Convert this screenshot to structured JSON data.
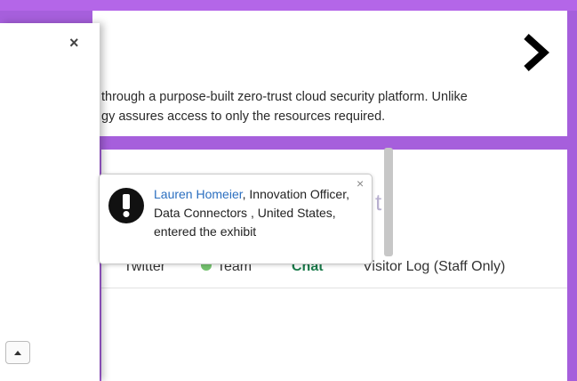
{
  "description": {
    "line1": "through a purpose-built zero-trust cloud security platform. Unlike",
    "line2": "gy assures access to only the resources required."
  },
  "navigation": {
    "next_icon": "chevron-right-icon"
  },
  "tabs": {
    "twitter": "Twitter",
    "team": "Team",
    "chat": "Chat",
    "visitor_log": "Visitor Log (Staff Only)"
  },
  "notification": {
    "name": "Lauren Homeier",
    "message": ", Innovation Officer, Data Connectors , United States, entered the exhibit",
    "icon": "alert-icon",
    "close": "×"
  },
  "side_panel": {
    "close": "×"
  },
  "colors": {
    "purple_bg": "#a65fdc",
    "link": "#2b6fc0",
    "chat_green": "#1a7a4a",
    "team_dot": "#74c16e"
  }
}
